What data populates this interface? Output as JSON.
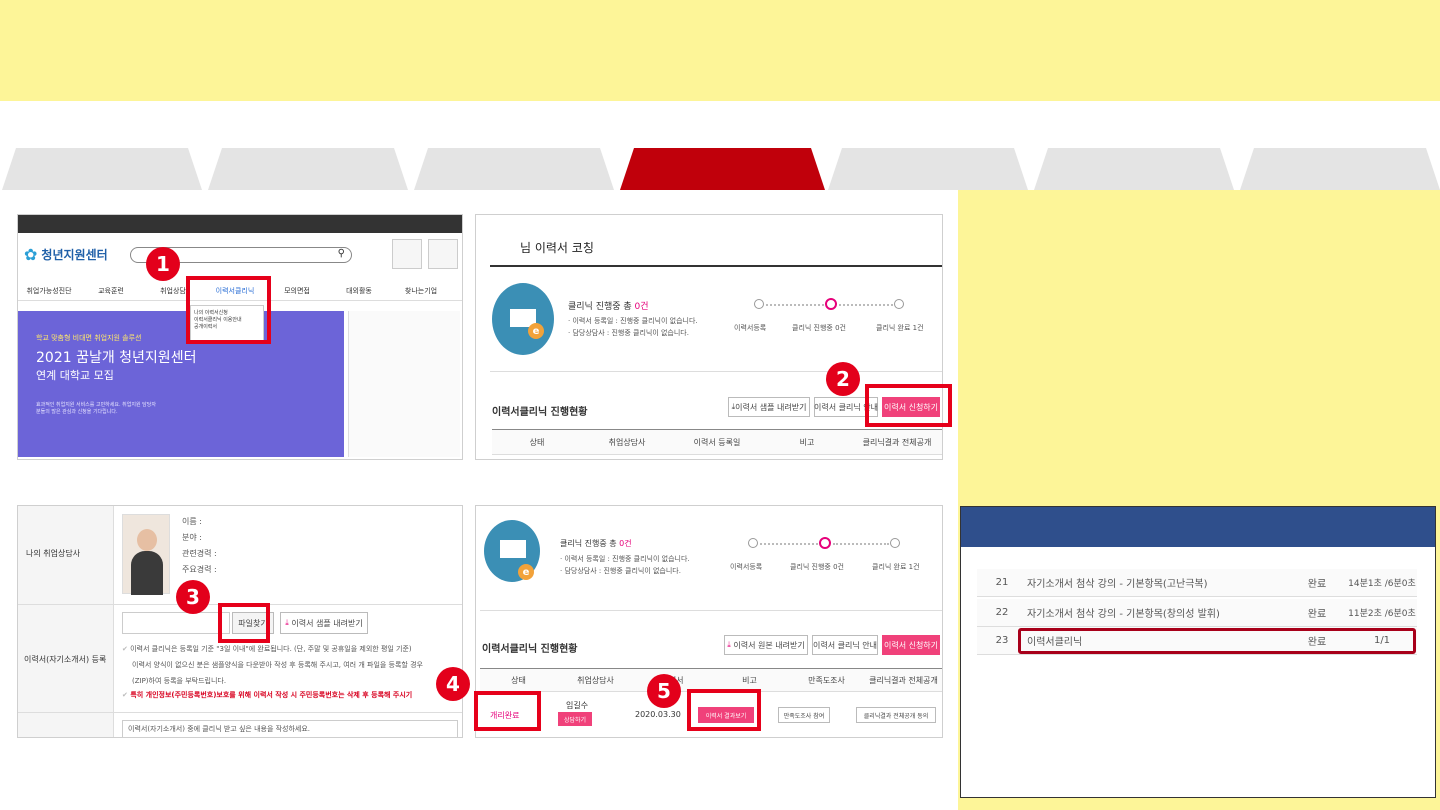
{
  "screen1": {
    "logo": "청년지원센터",
    "nav": [
      "취업가능성진단",
      "교육훈련",
      "취업상담",
      "이력서클리닉",
      "모의면접",
      "대외활동",
      "찾나는기업"
    ],
    "dropdown": [
      "나의 이력서신청",
      "이력서클리닉 이용안내",
      "공개이력서"
    ],
    "hero_small": "학교 맞춤형 비대면 취업지원 솔루션",
    "hero_title": "2021 꿈날개 청년지원센터",
    "hero_sub": "연계 대학교 모집",
    "hero_desc": "효과적인 취업지원 서비스를 고민하세요. 취업지원 담당자분들의 많은 관심과 신청을 기다립니다."
  },
  "screen2": {
    "heading": "님 이력서 코칭",
    "status_title_prefix": "클리닉 진행중 총 ",
    "status_count": "0건",
    "status_note1": "· 이력서 등록일 : 진행중 클리닉이 없습니다.",
    "status_note2": "· 담당상담사 : 진행중 클리닉이 없습니다.",
    "steps": [
      "이력서등록",
      "클리닉 진행중 0건",
      "클리닉 완료 1건"
    ],
    "section_title": "이력서클리닉 진행현황",
    "btn_download": "이력서 샘플 내려받기",
    "btn_guide": "이력서 클리닉 안내",
    "btn_apply": "이력서 신청하기",
    "columns": [
      "상태",
      "취업상담사",
      "이력서 등록일",
      "비고",
      "클리닉결과 전체공개"
    ]
  },
  "screen3": {
    "label_counselor": "나의 취업상담사",
    "info": [
      "이름 :",
      "분야 :",
      "관련경력 :",
      "주요경력 :"
    ],
    "btn_file": "파일찾기",
    "btn_sample": "이력서 샘플 내려받기",
    "label_register": "이력서(자기소개서) 등록",
    "note1": "이력서 클리닉은 등록일 기준 \"3일 이내\"에 완료됩니다. (단, 주말 및 공휴일을 제외한 평일 기준)",
    "note2": "이력서 양식이 없으신 분은 샘플양식을 다운받아 작성 후 등록해 주시고, 여러 개 파일을 등록할 경우",
    "note3": "(ZIP)하여 등록을 부탁드립니다.",
    "note4": "특히 개인정보(주민등록번호)보호를 위해 이력서 작성 시 주민등록번호는 삭제 후 등록해 주시기",
    "textarea": "이력서(자기소개서) 중에 클리닉 받고 싶은 내용을 작성하세요."
  },
  "screen4": {
    "status_title_prefix": "클리닉 진행중 총 ",
    "status_count": "0건",
    "status_note1": "· 이력서 등록일 : 진행중 클리닉이 없습니다.",
    "status_note2": "· 담당상담사 : 진행중 클리닉이 없습니다.",
    "steps": [
      "이력서등록",
      "클리닉 진행중 0건",
      "클리닉 완료 1건"
    ],
    "section_title": "이력서클리닉 진행현황",
    "btn_download": "이력서 원본 내려받기",
    "btn_guide": "이력서 클리닉 안내",
    "btn_apply": "이력서 신청하기",
    "columns": [
      "상태",
      "취업상담사",
      "이력서",
      "비고",
      "만족도조사",
      "클리닉결과 전체공개"
    ],
    "row": {
      "status": "개리완료",
      "counselor": "임길수",
      "counsel_btn": "상담하기",
      "date": "2020.03.30",
      "result_btn": "이력서 결과보기",
      "survey_btn": "만족도조사 참여",
      "public_btn": "클리닉결과 전체공개 동의"
    }
  },
  "side": {
    "rows": [
      {
        "no": "21",
        "title": "자기소개서 첨삭 강의 - 기본항목(고난극복)",
        "status": "완료",
        "time": "14분1초 /6분0초"
      },
      {
        "no": "22",
        "title": "자기소개서 첨삭 강의 - 기본항목(창의성 발휘)",
        "status": "완료",
        "time": "11분2초 /6분0초"
      },
      {
        "no": "23",
        "title": "이력서클리닉",
        "status": "완료",
        "time": "1/1"
      }
    ]
  },
  "badges": [
    "1",
    "2",
    "3",
    "4",
    "5"
  ]
}
